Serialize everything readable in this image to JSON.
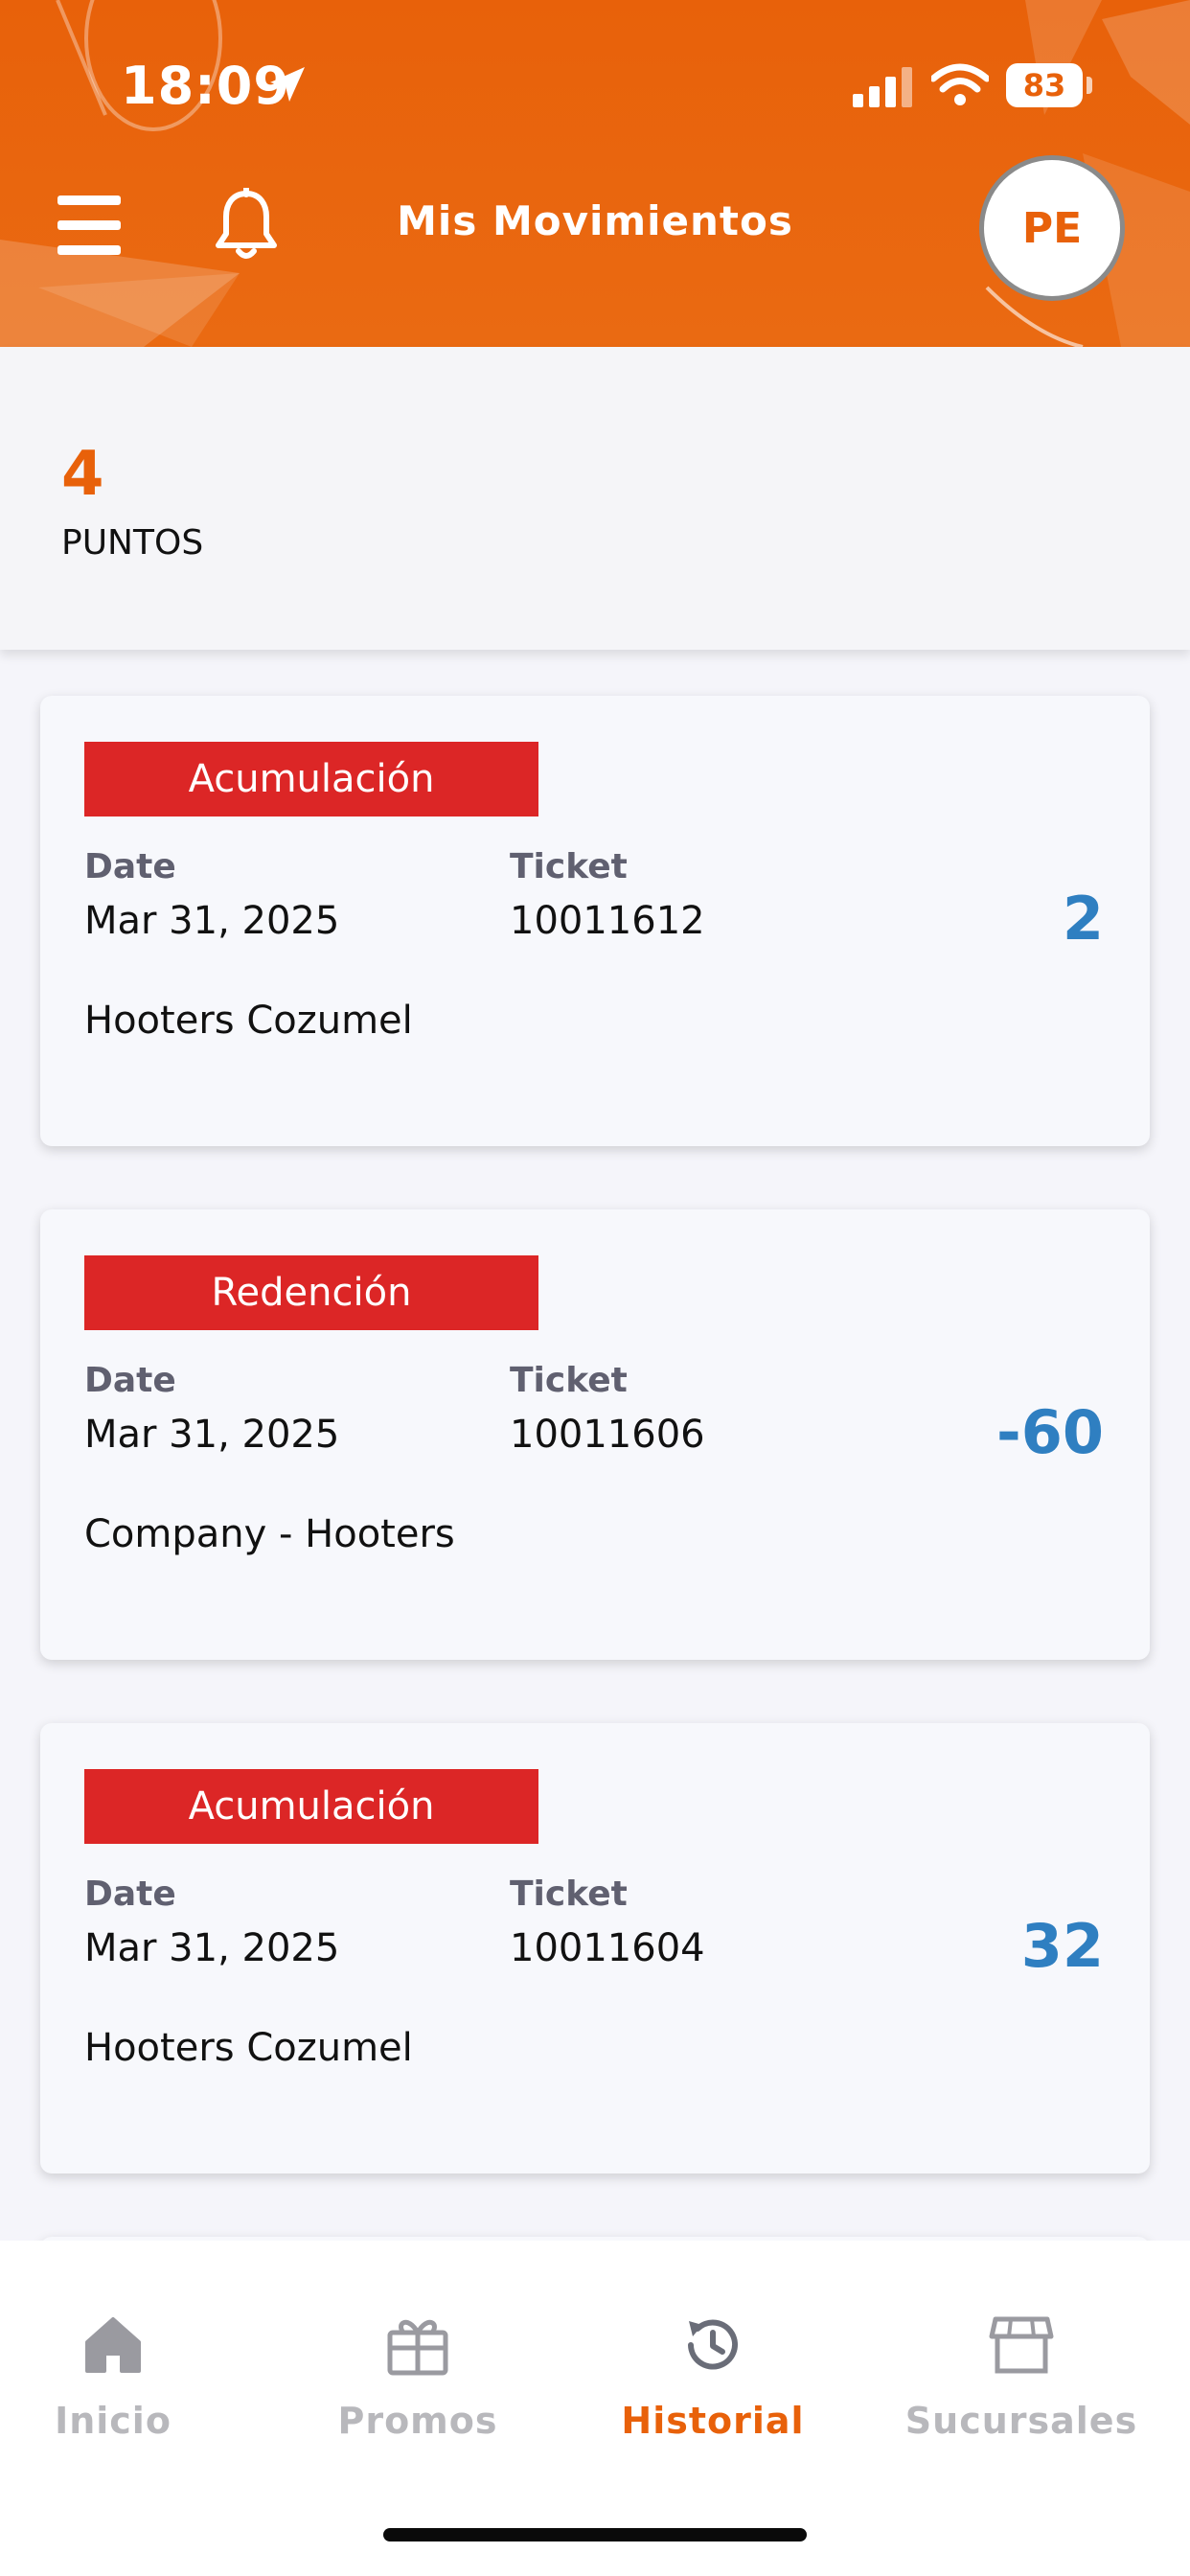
{
  "status_bar": {
    "time": "18:09",
    "battery": "83"
  },
  "header": {
    "title": "Mis Movimientos",
    "avatar_initials": "PE"
  },
  "summary": {
    "points": "4",
    "points_label": "PUNTOS"
  },
  "movements": [
    {
      "type": "Acumulación",
      "date_label": "Date",
      "date": "Mar 31, 2025",
      "ticket_label": "Ticket",
      "ticket": "10011612",
      "amount": "2",
      "store": "Hooters Cozumel"
    },
    {
      "type": "Redención",
      "date_label": "Date",
      "date": "Mar 31, 2025",
      "ticket_label": "Ticket",
      "ticket": "10011606",
      "amount": "-60",
      "store": "Company - Hooters"
    },
    {
      "type": "Acumulación",
      "date_label": "Date",
      "date": "Mar 31, 2025",
      "ticket_label": "Ticket",
      "ticket": "10011604",
      "amount": "32",
      "store": "Hooters Cozumel"
    }
  ],
  "nav": {
    "items": [
      {
        "label": "Inicio",
        "icon": "home-icon",
        "active": false
      },
      {
        "label": "Promos",
        "icon": "gift-icon",
        "active": false
      },
      {
        "label": "Historial",
        "icon": "history-icon",
        "active": true
      },
      {
        "label": "Sucursales",
        "icon": "store-icon",
        "active": false
      }
    ]
  },
  "colors": {
    "brand_orange": "#e8610a",
    "badge_red": "#dc2626",
    "amount_blue": "#2f7fc1"
  }
}
